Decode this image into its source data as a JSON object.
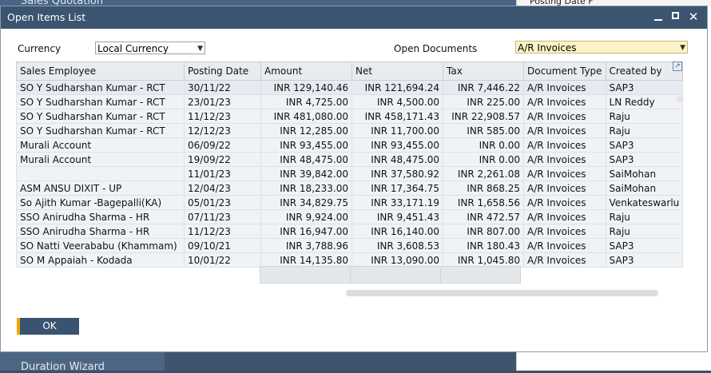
{
  "background": {
    "top_title": "Sales Quotation",
    "right_partial": "Posting Date F",
    "bottom_title": "Duration Wizard"
  },
  "dialog": {
    "title": "Open Items List",
    "controls": {
      "minimize": "_",
      "maximize": "□",
      "close": "✕"
    }
  },
  "filters": {
    "currency_label": "Currency",
    "currency_value": "Local Currency",
    "open_documents_label": "Open Documents",
    "open_documents_value": "A/R Invoices"
  },
  "table": {
    "columns": [
      "Sales Employee",
      "Posting Date",
      "Amount",
      "Net",
      "Tax",
      "Document Type",
      "Created by"
    ],
    "rows": [
      [
        "SO Y Sudharshan Kumar - RCT",
        "30/11/22",
        "INR 129,140.46",
        "INR 121,694.24",
        "INR 7,446.22",
        "A/R Invoices",
        "SAP3"
      ],
      [
        "SO Y Sudharshan Kumar - RCT",
        "23/01/23",
        "INR 4,725.00",
        "INR 4,500.00",
        "INR 225.00",
        "A/R Invoices",
        "LN Reddy"
      ],
      [
        "SO Y Sudharshan Kumar - RCT",
        "11/12/23",
        "INR 481,080.00",
        "INR 458,171.43",
        "INR 22,908.57",
        "A/R Invoices",
        "Raju"
      ],
      [
        "SO Y Sudharshan Kumar - RCT",
        "12/12/23",
        "INR 12,285.00",
        "INR 11,700.00",
        "INR 585.00",
        "A/R Invoices",
        "Raju"
      ],
      [
        "Murali Account",
        "06/09/22",
        "INR 93,455.00",
        "INR 93,455.00",
        "INR 0.00",
        "A/R Invoices",
        "SAP3"
      ],
      [
        "Murali Account",
        "19/09/22",
        "INR 48,475.00",
        "INR 48,475.00",
        "INR 0.00",
        "A/R Invoices",
        "SAP3"
      ],
      [
        "",
        "11/01/23",
        "INR 39,842.00",
        "INR 37,580.92",
        "INR 2,261.08",
        "A/R Invoices",
        "SaiMohan"
      ],
      [
        "ASM ANSU DIXIT - UP",
        "12/04/23",
        "INR 18,233.00",
        "INR 17,364.75",
        "INR 868.25",
        "A/R Invoices",
        "SaiMohan"
      ],
      [
        "So Ajith Kumar -Bagepalli(KA)",
        "05/01/23",
        "INR 34,829.75",
        "INR 33,171.19",
        "INR 1,658.56",
        "A/R Invoices",
        "Venkateswarlu"
      ],
      [
        "SSO Anirudha Sharma - HR",
        "07/11/23",
        "INR 9,924.00",
        "INR 9,451.43",
        "INR 472.57",
        "A/R Invoices",
        "Raju"
      ],
      [
        "SSO Anirudha Sharma - HR",
        "11/12/23",
        "INR 16,947.00",
        "INR 16,140.00",
        "INR 807.00",
        "A/R Invoices",
        "Raju"
      ],
      [
        "SO Natti Veerababu (Khammam)",
        "09/10/21",
        "INR 3,788.96",
        "INR 3,608.53",
        "INR 180.43",
        "A/R Invoices",
        "SAP3"
      ],
      [
        "SO M Appaiah - Kodada",
        "10/01/22",
        "INR 14,135.80",
        "INR 13,090.00",
        "INR 1,045.80",
        "A/R Invoices",
        "SAP3"
      ]
    ]
  },
  "buttons": {
    "ok": "OK"
  },
  "icons": {
    "expand": "expand-arrow-icon",
    "dropdown": "dropdown-arrow-icon"
  },
  "colors": {
    "titlebar": "#3b5470",
    "ok_accent": "#f0a800",
    "selected_field": "#fdf3c8"
  }
}
